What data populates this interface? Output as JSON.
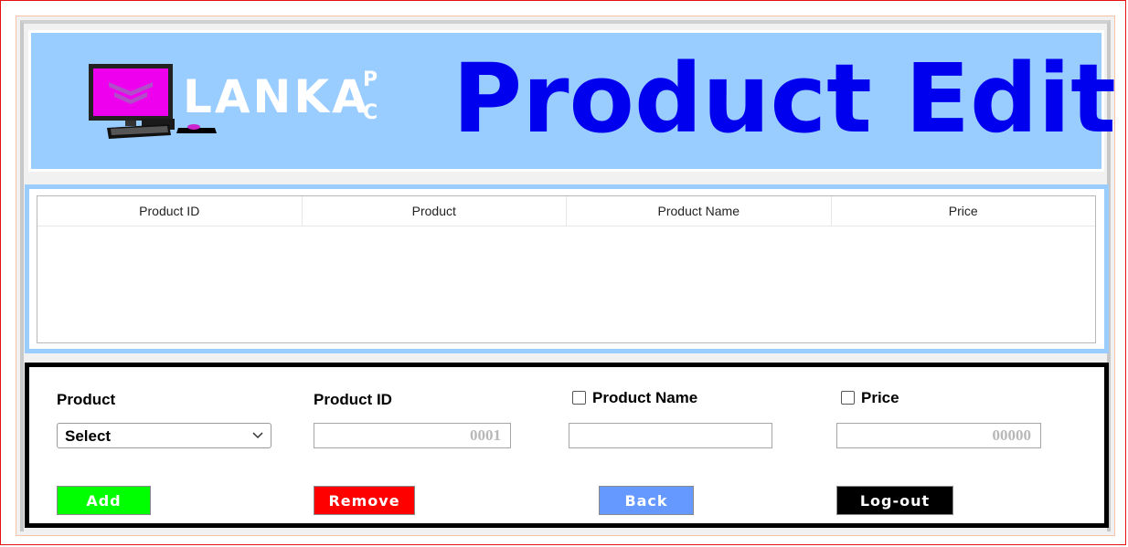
{
  "header": {
    "brand": "LANKA",
    "brand_vertical": "P C",
    "title": "Product Edit"
  },
  "grid": {
    "columns": [
      "Product ID",
      "Product",
      "Product Name",
      "Price"
    ]
  },
  "form": {
    "product_label": "Product",
    "product_select_value": "Select",
    "product_id_label": "Product ID",
    "product_id_value": "0001",
    "product_name_label": "Product Name",
    "product_name_value": "",
    "price_label": "Price",
    "price_value": "00000"
  },
  "buttons": {
    "add": "Add",
    "remove": "Remove",
    "back": "Back",
    "logout": "Log-out"
  },
  "colors": {
    "header_bg": "#99ccff",
    "title": "#0000ee",
    "add": "#00ff00",
    "remove": "#ff0000",
    "back": "#6699ff",
    "logout": "#000000"
  }
}
